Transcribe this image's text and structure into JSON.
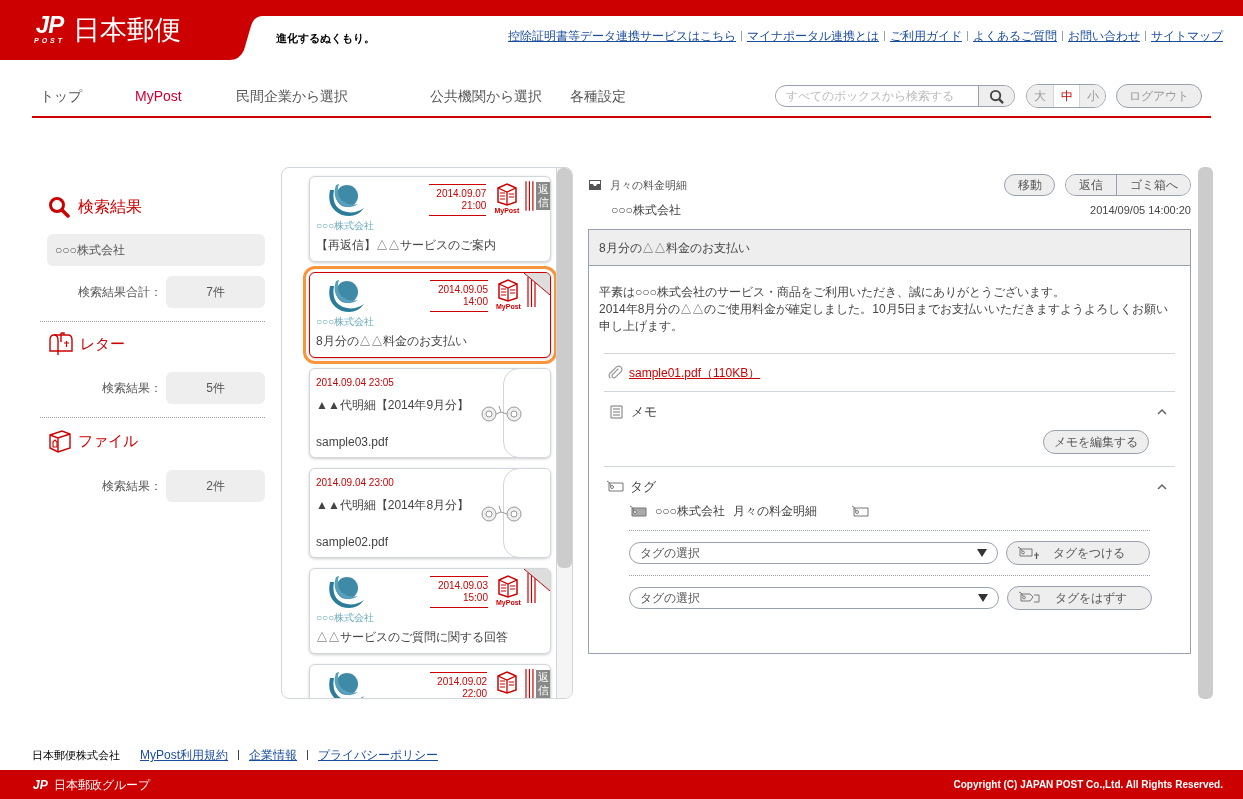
{
  "header": {
    "logo": {
      "mark": "JP",
      "sub": "POST",
      "name": "日本郵便"
    },
    "tagline": "進化するぬくもり。",
    "top_links": [
      "控除証明書等データ連携サービスはこちら",
      "マイナポータル連携とは",
      "ご利用ガイド",
      "よくあるご質問",
      "お問い合わせ",
      "サイトマップ"
    ]
  },
  "nav": {
    "items": [
      {
        "label": "トップ",
        "selected": false
      },
      {
        "label": "MyPost",
        "selected": true
      },
      {
        "label": "民間企業から選択",
        "selected": false
      },
      {
        "label": "公共機関から選択",
        "selected": false
      },
      {
        "label": "各種設定",
        "selected": false
      }
    ],
    "search": {
      "placeholder": "すべてのボックスから検索する"
    },
    "font_sizes": [
      {
        "label": "大",
        "selected": false
      },
      {
        "label": "中",
        "selected": true
      },
      {
        "label": "小",
        "selected": false
      }
    ],
    "logout": "ログアウト"
  },
  "sidebar": {
    "title": "検索結果",
    "query": "○○○株式会社",
    "total_label": "検索結果合計：",
    "total": "7件",
    "sections": [
      {
        "kind": "letter",
        "title": "レター",
        "label": "検索結果：",
        "count": "5件"
      },
      {
        "kind": "file",
        "title": "ファイル",
        "label": "検索結果：",
        "count": "2件"
      }
    ]
  },
  "messages": [
    {
      "kind": "letter",
      "logo_text": "○○○株式会社",
      "date": "2014.09.07",
      "time": "21:00",
      "service": "MyPost",
      "badge": "返信",
      "title": "【再返信】△△サービスのご案内",
      "folded": false,
      "selected": false
    },
    {
      "kind": "letter",
      "logo_text": "○○○株式会社",
      "date": "2014.09.05",
      "time": "14:00",
      "service": "MyPost",
      "title": "8月分の△△料金のお支払い",
      "folded": true,
      "selected": true
    },
    {
      "kind": "file",
      "datetime": "2014.09.04 23:05",
      "title": "▲▲代明細【2014年9月分】",
      "filename": "sample03.pdf",
      "folded": false,
      "selected": false
    },
    {
      "kind": "file",
      "datetime": "2014.09.04 23:00",
      "title": "▲▲代明細【2014年8月分】",
      "filename": "sample02.pdf",
      "folded": false,
      "selected": false
    },
    {
      "kind": "letter",
      "logo_text": "○○○株式会社",
      "date": "2014.09.03",
      "time": "15:00",
      "service": "MyPost",
      "title": "△△サービスのご質問に関する回答",
      "folded": true,
      "selected": false
    },
    {
      "kind": "letter",
      "date": "2014.09.02",
      "time": "22:00",
      "badge": "返信",
      "folded": false,
      "selected": false
    }
  ],
  "detail": {
    "folder": "月々の料金明細",
    "sender": "○○○株式会社",
    "buttons": [
      "移動",
      "返信",
      "ゴミ箱へ"
    ],
    "received": "2014/09/05 14:00:20",
    "subject": "8月分の△△料金のお支払い",
    "body": [
      "平素は○○○株式会社のサービス・商品をご利用いただき、誠にありがとうございます。",
      "2014年8月分の△△のご使用料金が確定しました。10月5日までお支払いいただきますようよろしくお願い申し上げます。"
    ],
    "attachment": "sample01.pdf（110KB）",
    "memo": {
      "title": "メモ",
      "expanded": true,
      "button": "メモを編集する"
    },
    "tags": {
      "title": "タグ",
      "expanded": true,
      "items": [
        "○○○株式会社",
        "月々の料金明細"
      ],
      "rows": [
        {
          "kind": "add",
          "placeholder": "タグの選択",
          "button": "タグをつける"
        },
        {
          "kind": "remove",
          "placeholder": "タグの選択",
          "button": "タグをはずす"
        }
      ]
    }
  },
  "footer": {
    "company": "日本郵便株式会社",
    "links": [
      "MyPost利用規約",
      "企業情報",
      "プライバシーポリシー"
    ],
    "group_mark": "JP",
    "group": "日本郵政グループ",
    "copyright": "Copyright (C) JAPAN POST Co.,Ltd. All Rights Reserved."
  }
}
